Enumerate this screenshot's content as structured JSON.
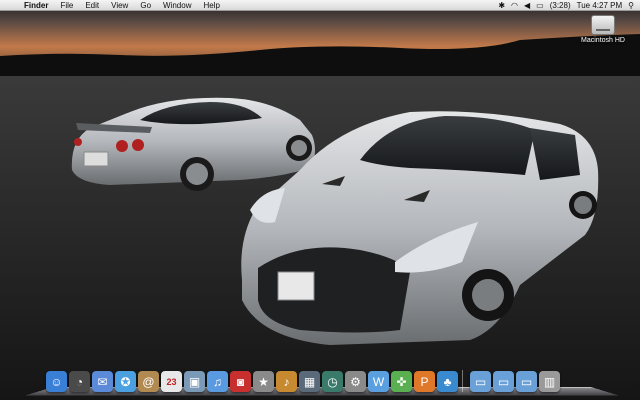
{
  "menubar": {
    "apple": "",
    "app_name": "Finder",
    "menus": [
      "File",
      "Edit",
      "View",
      "Go",
      "Window",
      "Help"
    ],
    "battery": "(3:28)",
    "clock": "Tue 4:27 PM"
  },
  "desktop": {
    "disk_label": "Macintosh HD"
  },
  "dock": {
    "icons": [
      {
        "name": "finder-icon",
        "glyph": "☺",
        "color": "#3a7fd6"
      },
      {
        "name": "dashboard-icon",
        "glyph": "◔",
        "color": "#4a4a4a"
      },
      {
        "name": "mail-icon",
        "glyph": "✉",
        "color": "#5a8ad8"
      },
      {
        "name": "safari-icon",
        "glyph": "✪",
        "color": "#4aa0e0"
      },
      {
        "name": "address-book-icon",
        "glyph": "@",
        "color": "#b08a50"
      },
      {
        "name": "ical-icon",
        "glyph": "23",
        "color": "#e8e8e8"
      },
      {
        "name": "iphoto-icon",
        "glyph": "▣",
        "color": "#7a9ab8"
      },
      {
        "name": "itunes-icon",
        "glyph": "♫",
        "color": "#5a9ae0"
      },
      {
        "name": "photo-booth-icon",
        "glyph": "◙",
        "color": "#c83030"
      },
      {
        "name": "imovie-icon",
        "glyph": "★",
        "color": "#8a8a8a"
      },
      {
        "name": "garageband-icon",
        "glyph": "♪",
        "color": "#c88a30"
      },
      {
        "name": "spaces-icon",
        "glyph": "▦",
        "color": "#5a6a7a"
      },
      {
        "name": "time-machine-icon",
        "glyph": "◷",
        "color": "#3a7a6a"
      },
      {
        "name": "system-preferences-icon",
        "glyph": "⚙",
        "color": "#8a8a8a"
      },
      {
        "name": "wu-icon",
        "glyph": "W",
        "color": "#5aa0e0"
      },
      {
        "name": "app-green-icon",
        "glyph": "✜",
        "color": "#5ab050"
      },
      {
        "name": "app-orange-icon",
        "glyph": "P",
        "color": "#e0782a"
      },
      {
        "name": "app-people-icon",
        "glyph": "♣",
        "color": "#3a8ad0"
      },
      {
        "name": "folder-applications-icon",
        "glyph": "▭",
        "color": "#6aa0d8"
      },
      {
        "name": "folder-documents-icon",
        "glyph": "▭",
        "color": "#6aa0d8"
      },
      {
        "name": "folder-downloads-icon",
        "glyph": "▭",
        "color": "#6aa0d8"
      },
      {
        "name": "trash-icon",
        "glyph": "▥",
        "color": "#9a9a9a"
      }
    ]
  },
  "colors": {
    "menubar": "#e6e6e6",
    "sky_top": "#1a1a1d",
    "sky_glow": "#c27a4a",
    "car_silver": "#b9bcc0"
  }
}
